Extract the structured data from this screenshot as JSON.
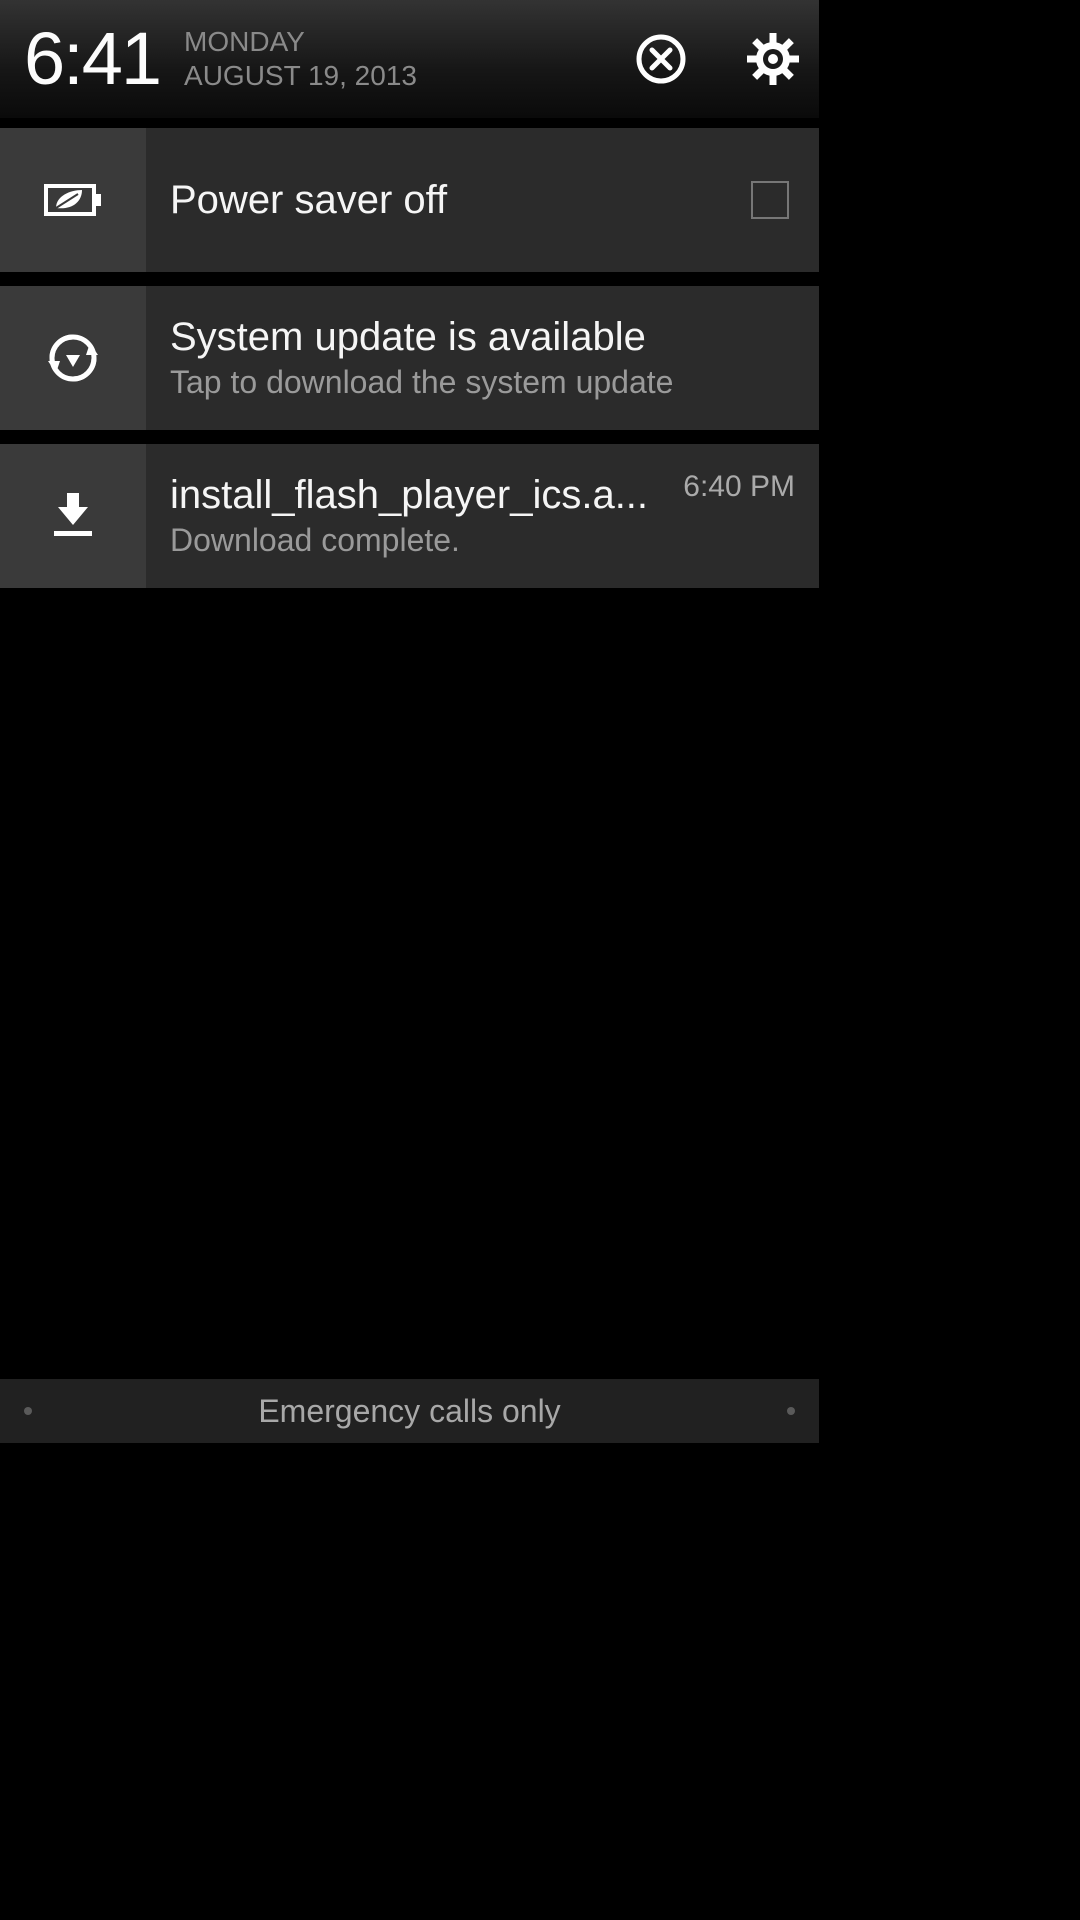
{
  "header": {
    "time": "6:41",
    "day": "MONDAY",
    "date": "AUGUST 19, 2013"
  },
  "powersaver": {
    "label": "Power saver off"
  },
  "update": {
    "title": "System update is available",
    "sub": "Tap to download the system update"
  },
  "download": {
    "title": "install_flash_player_ics.a...",
    "sub": "Download complete.",
    "time": "6:40 PM"
  },
  "footer": {
    "text": "Emergency calls only"
  }
}
